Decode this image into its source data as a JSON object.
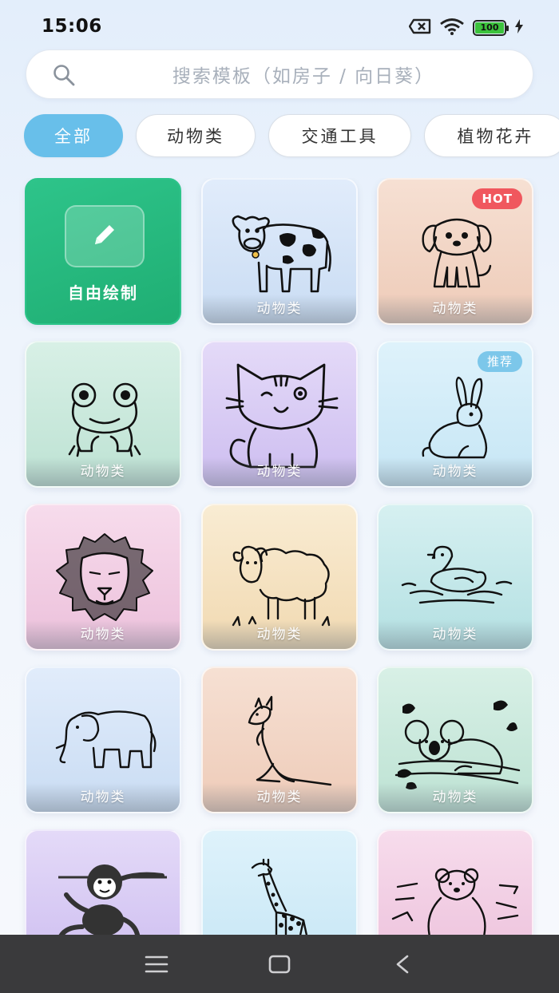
{
  "status": {
    "time": "15:06",
    "battery": "100",
    "icons": [
      "sim-error-icon",
      "wifi-icon",
      "battery-icon",
      "charging-icon"
    ]
  },
  "search": {
    "placeholder": "搜索模板（如房子 / 向日葵）",
    "icon": "search-icon"
  },
  "tabs": [
    {
      "label": "全部",
      "active": true
    },
    {
      "label": "动物类",
      "active": false
    },
    {
      "label": "交通工具",
      "active": false
    },
    {
      "label": "植物花卉",
      "active": false
    }
  ],
  "free_draw": {
    "label": "自由绘制",
    "icon": "pencil-icon"
  },
  "cards": [
    {
      "subject": "cow",
      "label": "动物类",
      "badge": ""
    },
    {
      "subject": "puppy",
      "label": "动物类",
      "badge": "HOT"
    },
    {
      "subject": "frog",
      "label": "动物类",
      "badge": ""
    },
    {
      "subject": "cat",
      "label": "动物类",
      "badge": ""
    },
    {
      "subject": "rabbit",
      "label": "动物类",
      "badge": "推荐"
    },
    {
      "subject": "lion",
      "label": "动物类",
      "badge": ""
    },
    {
      "subject": "sheep",
      "label": "动物类",
      "badge": ""
    },
    {
      "subject": "duck",
      "label": "动物类",
      "badge": ""
    },
    {
      "subject": "elephant",
      "label": "动物类",
      "badge": ""
    },
    {
      "subject": "kangaroo",
      "label": "动物类",
      "badge": ""
    },
    {
      "subject": "koala",
      "label": "动物类",
      "badge": ""
    },
    {
      "subject": "monkey",
      "label": "",
      "badge": ""
    },
    {
      "subject": "giraffe",
      "label": "",
      "badge": ""
    },
    {
      "subject": "bear",
      "label": "",
      "badge": ""
    }
  ],
  "nav": {
    "buttons": [
      "menu-icon",
      "home-icon",
      "back-icon"
    ]
  },
  "colors": {
    "accent": "#68bfea",
    "free_draw": "#22b47c",
    "hot": "#f0575e",
    "recommend": "#7cc7ea"
  }
}
